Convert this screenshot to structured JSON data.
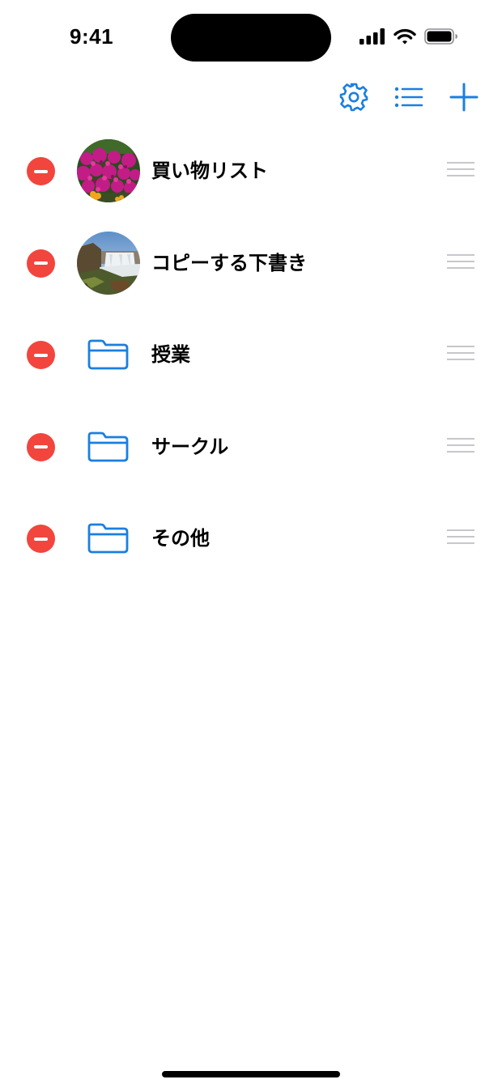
{
  "status_bar": {
    "time": "9:41"
  },
  "toolbar": {
    "buttons": [
      {
        "icon": "gear-icon"
      },
      {
        "icon": "list-icon"
      },
      {
        "icon": "plus-icon"
      }
    ]
  },
  "items": [
    {
      "label": "買い物リスト",
      "thumbnail": "photo-flowers"
    },
    {
      "label": "コピーする下書き",
      "thumbnail": "photo-waterfall"
    },
    {
      "label": "授業",
      "thumbnail": "folder-icon"
    },
    {
      "label": "サークル",
      "thumbnail": "folder-icon"
    },
    {
      "label": "その他",
      "thumbnail": "folder-icon"
    }
  ],
  "colors": {
    "accent": "#1a7fe0",
    "delete": "#f2453d",
    "handle": "#c7c7cc"
  }
}
